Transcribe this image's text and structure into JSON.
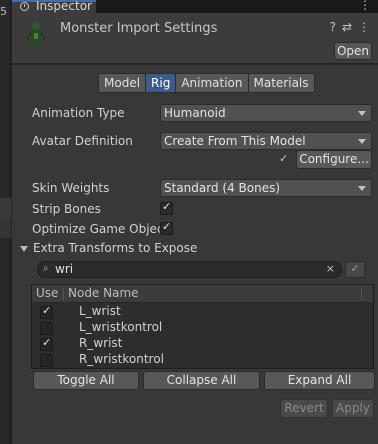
{
  "gutter": {
    "number": "5"
  },
  "tab": {
    "title": "Inspector",
    "menu_glyph": "⋮"
  },
  "header": {
    "title": "Monster Import Settings",
    "help_glyph": "?",
    "preset_glyph": "⇄",
    "menu_glyph": "⋮",
    "open_label": "Open"
  },
  "tabs": [
    "Model",
    "Rig",
    "Animation",
    "Materials"
  ],
  "active_tab": "Rig",
  "fields": {
    "animation_type": {
      "label": "Animation Type",
      "value": "Humanoid"
    },
    "avatar_definition": {
      "label": "Avatar Definition",
      "value": "Create From This Model"
    },
    "configure_label": "Configure...",
    "configure_check": "✓",
    "skin_weights": {
      "label": "Skin Weights",
      "value": "Standard (4 Bones)"
    },
    "strip_bones": {
      "label": "Strip Bones",
      "checked": true
    },
    "optimize_game_objects": {
      "label": "Optimize Game Object",
      "checked": true
    }
  },
  "extra_transforms": {
    "label": "Extra Transforms to Expose",
    "search_value": "wri",
    "search_icon_glyph": "⌕",
    "clear_glyph": "×",
    "confirm_glyph": "✓",
    "columns": [
      "Use",
      "Node Name"
    ],
    "rows": [
      {
        "use": true,
        "name": "L_wrist"
      },
      {
        "use": false,
        "name": "L_wristkontrol"
      },
      {
        "use": true,
        "name": "R_wrist"
      },
      {
        "use": false,
        "name": "R_wristkontrol"
      }
    ]
  },
  "buttons": {
    "toggle_all": "Toggle All",
    "collapse_all": "Collapse All",
    "expand_all": "Expand All",
    "revert": "Revert",
    "apply": "Apply"
  },
  "colors": {
    "tab_accent": "#3d6fb5",
    "active_segment": "#3c5d8a",
    "panel_bg": "#383838",
    "header_bg": "#3c3c3c"
  }
}
